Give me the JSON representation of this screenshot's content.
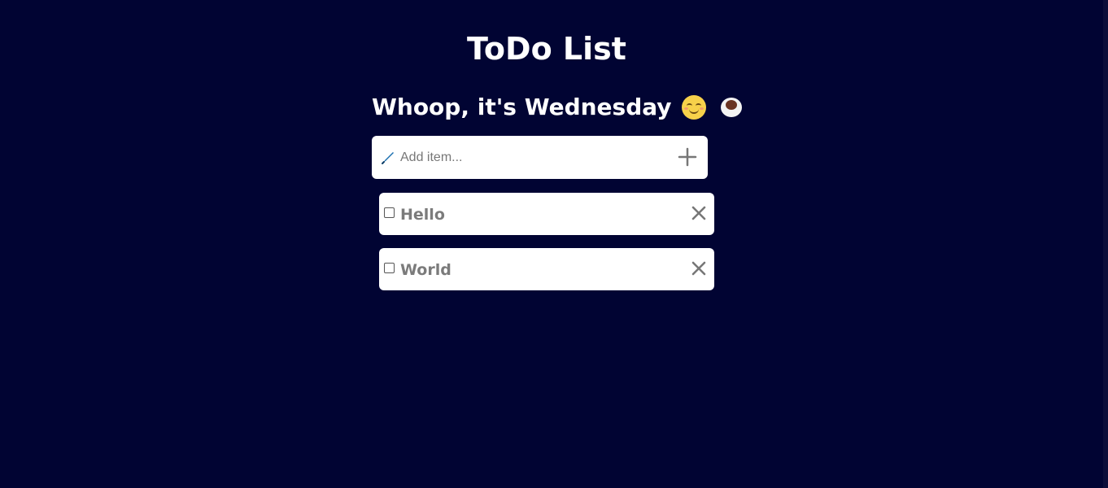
{
  "app": {
    "title": "ToDo List",
    "greeting": "Whoop, it's Wednesday",
    "greeting_emojis": [
      "smiling-face-icon",
      "hot-beverage-icon"
    ]
  },
  "add_item": {
    "placeholder": "Add item...",
    "value": "",
    "icon": "pen-icon",
    "button_icon": "plus-icon"
  },
  "items": [
    {
      "label": "Hello",
      "checked": false
    },
    {
      "label": "World",
      "checked": false
    }
  ],
  "colors": {
    "background": "#010433",
    "card": "#ffffff",
    "item_text": "#7b7b7b",
    "icon_gray": "#777777",
    "pen_blue": "#1a6fb0"
  }
}
